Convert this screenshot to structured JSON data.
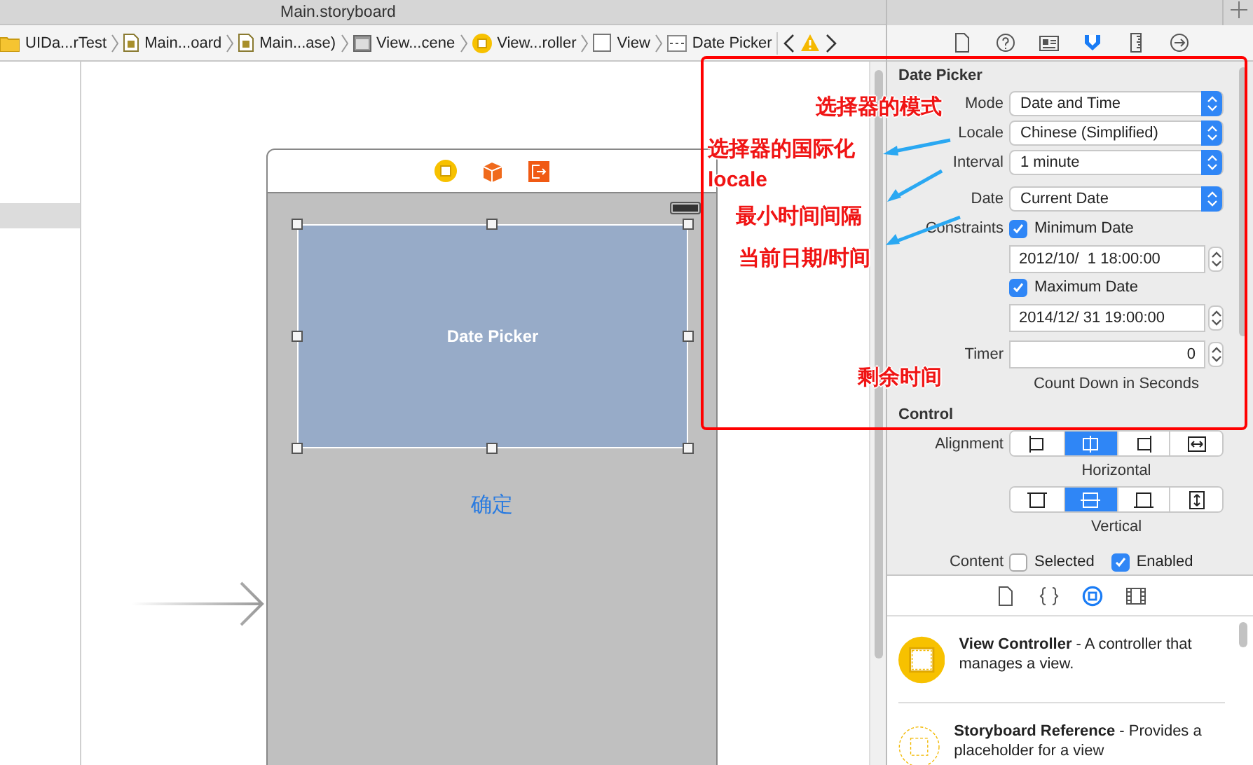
{
  "window": {
    "title": "Main.storyboard"
  },
  "breadcrumbs": [
    {
      "label": "UIDa...rTest",
      "kind": "folder"
    },
    {
      "label": "Main...oard",
      "kind": "file"
    },
    {
      "label": "Main...ase)",
      "kind": "file"
    },
    {
      "label": "View...cene",
      "kind": "scene"
    },
    {
      "label": "View...roller",
      "kind": "controller"
    },
    {
      "label": "View",
      "kind": "view"
    },
    {
      "label": "Date Picker",
      "kind": "picker"
    }
  ],
  "canvas": {
    "picker_label": "Date Picker",
    "button_label": "确定"
  },
  "inspector_tabs": [
    {
      "kind": "file",
      "selected": false
    },
    {
      "kind": "help",
      "selected": false
    },
    {
      "kind": "identity",
      "selected": false
    },
    {
      "kind": "attributes",
      "selected": true
    },
    {
      "kind": "size",
      "selected": false
    },
    {
      "kind": "connections",
      "selected": false
    }
  ],
  "date_picker_section": {
    "title": "Date Picker",
    "rows": [
      {
        "kind": "popup",
        "label": "Mode",
        "value": "Date and Time"
      },
      {
        "kind": "popup",
        "label": "Locale",
        "value": "Chinese (Simplified)"
      },
      {
        "kind": "popup",
        "label": "Interval",
        "value": "1 minute"
      },
      {
        "kind": "divider"
      },
      {
        "kind": "popup",
        "label": "Date",
        "value": "Current Date"
      },
      {
        "kind": "check",
        "label": "Constraints",
        "text": "Minimum Date",
        "checked": true
      },
      {
        "kind": "stepper",
        "value": "2012/10/  1 18:00:00"
      },
      {
        "kind": "check",
        "text": "Maximum Date",
        "checked": true
      },
      {
        "kind": "stepper",
        "value": "2014/12/ 31 19:00:00"
      },
      {
        "kind": "divider"
      },
      {
        "kind": "number",
        "label": "Timer",
        "value": "0",
        "caption": "Count Down in Seconds"
      }
    ]
  },
  "control_section": {
    "title": "Control",
    "alignment_label": "Alignment",
    "groups": [
      {
        "caption": "Horizontal",
        "segments": [
          {
            "kind": "left",
            "selected": false
          },
          {
            "kind": "center-h",
            "selected": true
          },
          {
            "kind": "right",
            "selected": false
          },
          {
            "kind": "fill-h",
            "selected": false
          }
        ]
      },
      {
        "caption": "Vertical",
        "segments": [
          {
            "kind": "top",
            "selected": false
          },
          {
            "kind": "center-v",
            "selected": true
          },
          {
            "kind": "bottom",
            "selected": false
          },
          {
            "kind": "fill-v",
            "selected": false
          }
        ]
      }
    ],
    "content_label": "Content",
    "content_options": [
      {
        "text": "Selected",
        "checked": false
      },
      {
        "text": "Enabled",
        "checked": true
      }
    ]
  },
  "library_tabs": [
    {
      "kind": "file",
      "selected": false
    },
    {
      "kind": "braces",
      "selected": false
    },
    {
      "kind": "object",
      "selected": true
    },
    {
      "kind": "media",
      "selected": false
    }
  ],
  "library_items": [
    {
      "kind": "solid",
      "text": "**View Controller** - A controller that manages a view."
    },
    {
      "kind": "dashed",
      "text": "**Storyboard Reference** - Provides a placeholder for a view"
    }
  ],
  "annotations": [
    {
      "text": "选择器的模式"
    },
    {
      "text": "选择器的国际化"
    },
    {
      "text": "locale"
    },
    {
      "text": "最小时间间隔"
    },
    {
      "text": "当前日期/时间"
    },
    {
      "text": "剩余时间"
    }
  ]
}
